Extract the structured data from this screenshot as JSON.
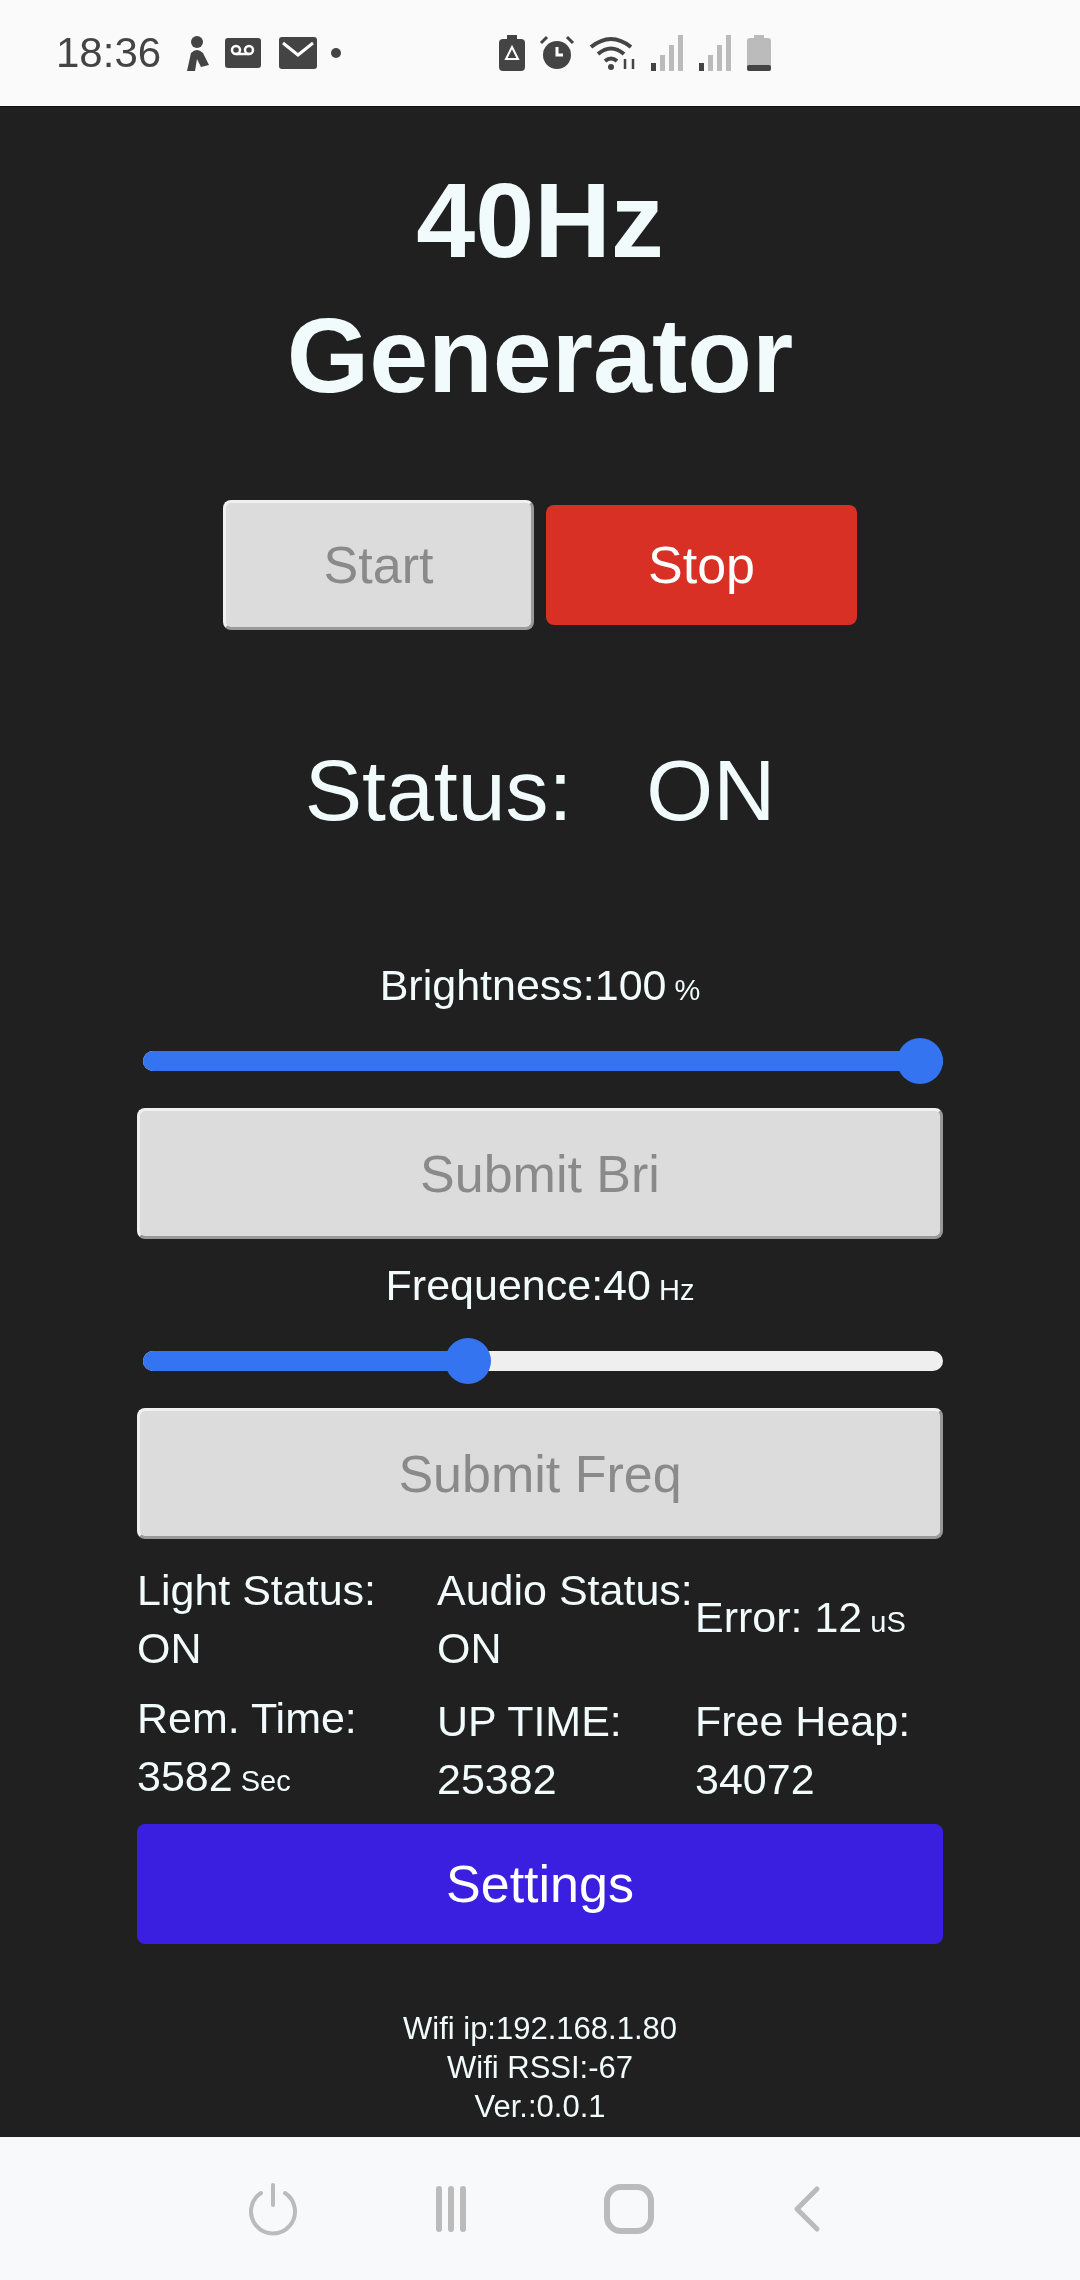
{
  "status_bar": {
    "time": "18:36"
  },
  "title": [
    "40Hz",
    "Generator"
  ],
  "buttons": [
    {
      "label": "Start",
      "kind": "default"
    },
    {
      "label": "Stop",
      "kind": "danger"
    }
  ],
  "status": {
    "label": "Status:",
    "value": "ON"
  },
  "controls": [
    {
      "label": "Brightness:",
      "value": "100",
      "unit": "%",
      "level": 1.0,
      "button": "Submit Bri"
    },
    {
      "label": "Frequence:",
      "value": "40",
      "unit": "Hz",
      "level": 0.4,
      "button": "Submit Freq"
    }
  ],
  "stats": [
    {
      "label": "Light Status:",
      "value": "ON"
    },
    {
      "label": "Audio Status:",
      "value": "ON"
    },
    {
      "label": "Error:",
      "value": "12",
      "unit": "uS"
    },
    {
      "label": "Rem. Time:",
      "value": "3582",
      "unit": "Sec"
    },
    {
      "label": "UP TIME:",
      "value": "25382"
    },
    {
      "label": "Free Heap:",
      "value": "34072"
    }
  ],
  "settings_button": "Settings",
  "footer": [
    "Wifi ip:192.168.1.80",
    "Wifi RSSI:-67",
    "Ver.:0.0.1"
  ]
}
